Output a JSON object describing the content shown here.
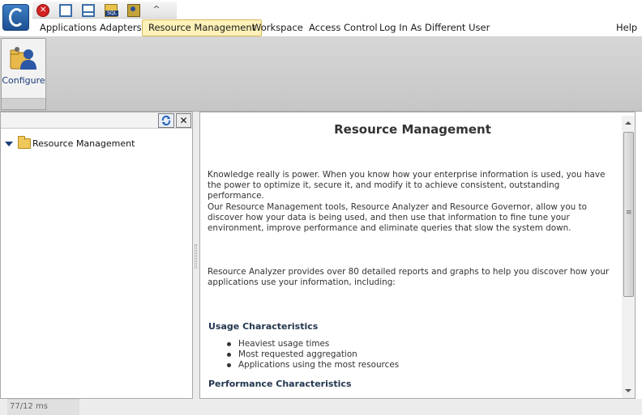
{
  "quickbar": {
    "icons": [
      "close-session-icon",
      "window-icon",
      "window-taskbar-icon",
      "sql-icon",
      "users-icon",
      "collapse-icon"
    ],
    "sql_badge": "SQL",
    "collapse_glyph": "^"
  },
  "menubar": {
    "items": [
      {
        "label": "Applications"
      },
      {
        "label": "Adapters"
      },
      {
        "label": "Resource Management",
        "active": true
      },
      {
        "label": "Workspace"
      },
      {
        "label": "Access Control"
      },
      {
        "label": "Log In As Different User"
      }
    ],
    "help_label": "Help"
  },
  "ribbon": {
    "configure_label": "Configure"
  },
  "left_panel": {
    "close_glyph": "✕",
    "tree": {
      "root_label": "Resource Management",
      "expanded": true
    }
  },
  "content": {
    "title": "Resource Management",
    "paragraph_1": "Knowledge really is power. When you know how your enterprise information is used, you have the power to optimize it, secure it, and modify it to achieve consistent, outstanding performance.",
    "paragraph_2": "Our Resource Management tools, Resource Analyzer and Resource Governor, allow you to discover how your data is being used, and then use that information to fine tune your environment, improve performance and eliminate queries that slow the system down.",
    "paragraph_3": "Resource Analyzer provides over 80 detailed reports and graphs to help you discover how your applications use your information, including:",
    "usage_heading": "Usage Characteristics",
    "usage_items": [
      "Heaviest usage times",
      "Most requested aggregation",
      "Applications using the most resources"
    ],
    "performance_heading": "Performance Characteristics"
  },
  "status": {
    "text": "77/12 ms"
  },
  "colors": {
    "menu_active_bg": "#fff2b8",
    "title_text": "#333333",
    "brand_blue": "#1d4f91"
  }
}
